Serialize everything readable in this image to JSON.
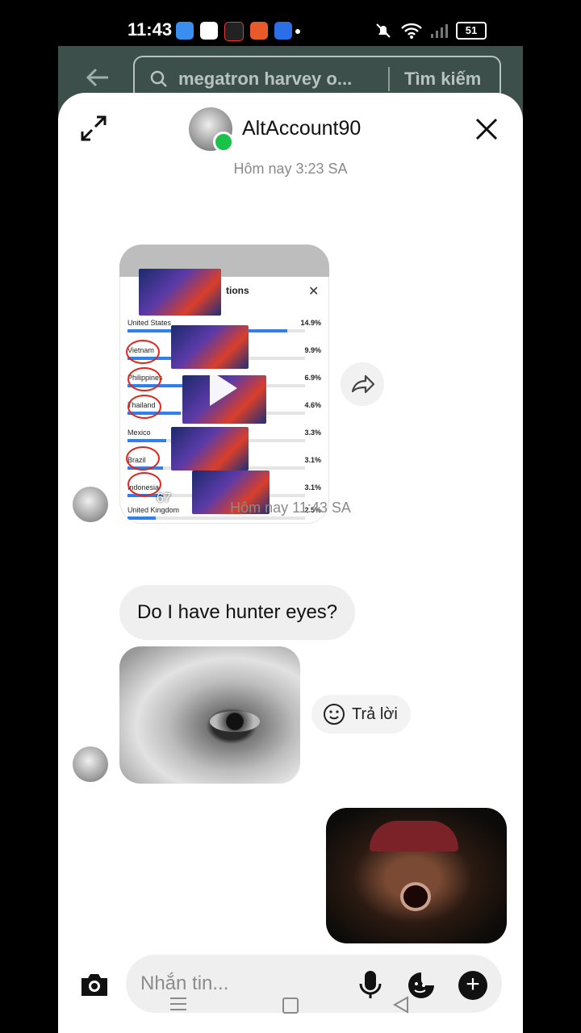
{
  "status_bar": {
    "time": "11:43",
    "battery": "51"
  },
  "background_app": {
    "search_text": "megatron harvey o...",
    "search_button": "Tìm kiếm"
  },
  "header": {
    "username": "AltAccount90"
  },
  "messages": {
    "timestamp_1": "Hôm nay 3:23 SA",
    "video": {
      "panel_title": "tions",
      "views": "67",
      "rows": [
        {
          "country": "United States",
          "pct": "14.9%",
          "fill": 0.9
        },
        {
          "country": "Vietnam",
          "pct": "9.9%",
          "fill": 0.6
        },
        {
          "country": "Philippines",
          "pct": "6.9%",
          "fill": 0.42
        },
        {
          "country": "Thailand",
          "pct": "4.6%",
          "fill": 0.3
        },
        {
          "country": "Mexico",
          "pct": "3.3%",
          "fill": 0.22
        },
        {
          "country": "Brazil",
          "pct": "3.1%",
          "fill": 0.2
        },
        {
          "country": "Indonesia",
          "pct": "3.1%",
          "fill": 0.2
        },
        {
          "country": "United Kingdom",
          "pct": "2.5%",
          "fill": 0.16
        }
      ]
    },
    "timestamp_2": "Hôm nay 11:43 SA",
    "text_message": "Do I have hunter eyes?",
    "reply_label": "Trả lời"
  },
  "composer": {
    "placeholder": "Nhắn tin..."
  }
}
